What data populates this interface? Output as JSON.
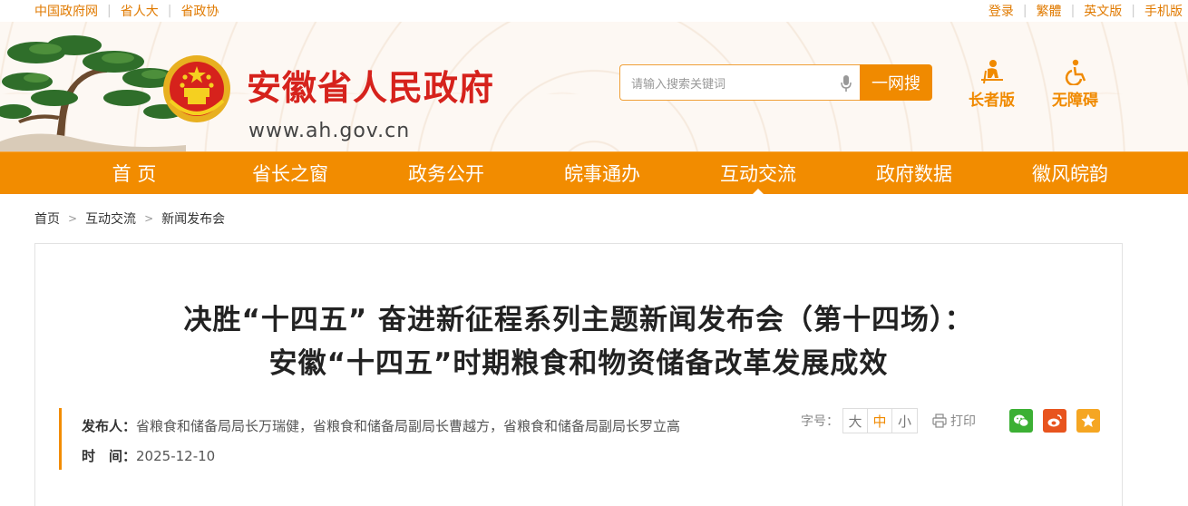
{
  "topbar": {
    "left_links": [
      "中国政府网",
      "省人大",
      "省政协"
    ],
    "right_links": [
      "登录",
      "繁體",
      "英文版",
      "手机版"
    ]
  },
  "header": {
    "site_title": "安徽省人民政府",
    "site_url": "www.ah.gov.cn",
    "search_placeholder": "请输入搜索关键词",
    "search_button": "一网搜",
    "elder_label": "长者版",
    "barrier_free_label": "无障碍"
  },
  "nav": {
    "items": [
      "首 页",
      "省长之窗",
      "政务公开",
      "皖事通办",
      "互动交流",
      "政府数据",
      "徽风皖韵"
    ],
    "active": "互动交流"
  },
  "breadcrumb": [
    "首页",
    "互动交流",
    "新闻发布会"
  ],
  "article": {
    "title_line1": "决胜“十四五” 奋进新征程系列主题新闻发布会（第十四场）：",
    "title_line2": "安徽“十四五”时期粮食和物资储备改革发展成效",
    "publisher_label": "发布人：",
    "publisher": "省粮食和储备局局长万瑞健，省粮食和储备局副局长曹越方，省粮食和储备局副局长罗立高",
    "time_label": "时　间：",
    "time": "2025-12-10",
    "font_size_label": "字号：",
    "font_sizes": [
      "大",
      "中",
      "小"
    ],
    "font_size_selected": "中",
    "print_label": "打印"
  },
  "colors": {
    "brand_orange": "#f28c00",
    "title_red": "#d6221c",
    "wechat_green": "#3cb034",
    "weibo_orange": "#e8541e",
    "favorite_orange": "#f5a623"
  },
  "icons": {
    "search_voice": "microphone-icon",
    "elder": "elder-person-icon",
    "barrier_free": "wheelchair-icon",
    "print": "printer-icon",
    "share": [
      "wechat-icon",
      "weibo-icon",
      "star-icon"
    ]
  }
}
